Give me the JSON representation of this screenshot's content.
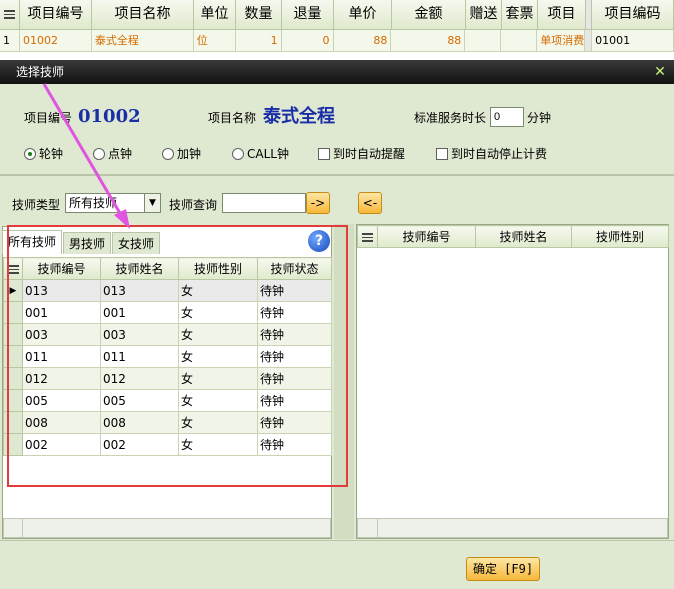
{
  "background_grid": {
    "columns": [
      "",
      "项目编号",
      "项目名称",
      "单位",
      "数量",
      "退量",
      "单价",
      "金额",
      "赠送",
      "套票",
      "项目",
      "项目编码"
    ],
    "row": [
      "1",
      "01002",
      "泰式全程",
      "位",
      "1",
      "0",
      "88",
      "88",
      "",
      "",
      "单项消费",
      "01001"
    ]
  },
  "dialog": {
    "title": "选择技师",
    "item_code_label": "项目编号",
    "item_code": "01002",
    "item_name_label": "项目名称",
    "item_name": "泰式全程",
    "duration_label": "标准服务时长",
    "duration_value": "0",
    "duration_unit": "分钟",
    "radios": [
      {
        "label": "轮钟",
        "checked": true
      },
      {
        "label": "点钟",
        "checked": false
      },
      {
        "label": "加钟",
        "checked": false
      },
      {
        "label": "CALL钟",
        "checked": false
      }
    ],
    "checkboxes": [
      {
        "label": "到时自动提醒"
      },
      {
        "label": "到时自动停止计费"
      }
    ],
    "tech_type_label": "技师类型",
    "tech_type_value": "所有技师",
    "tech_query_label": "技师查询",
    "tabs": [
      "所有技师",
      "男技师",
      "女技师"
    ],
    "left_table": {
      "headers": [
        "技师编号",
        "技师姓名",
        "技师性别",
        "技师状态"
      ],
      "rows": [
        [
          "013",
          "013",
          "女",
          "待钟"
        ],
        [
          "001",
          "001",
          "女",
          "待钟"
        ],
        [
          "003",
          "003",
          "女",
          "待钟"
        ],
        [
          "011",
          "011",
          "女",
          "待钟"
        ],
        [
          "012",
          "012",
          "女",
          "待钟"
        ],
        [
          "005",
          "005",
          "女",
          "待钟"
        ],
        [
          "008",
          "008",
          "女",
          "待钟"
        ],
        [
          "002",
          "002",
          "女",
          "待钟"
        ]
      ]
    },
    "right_table": {
      "headers": [
        "技师编号",
        "技师姓名",
        "技师性别"
      ]
    },
    "add_button": "->",
    "remove_button": "<-",
    "confirm_button": "确定 [F9]",
    "colors": {
      "title_bg": "#1a1a1a",
      "panel_bg": "#dfe8d0",
      "accent_blue": "#1a2ea8",
      "highlight_red": "#e23b3b",
      "annotation_arrow": "#e055e0"
    },
    "icons": [
      "close-icon",
      "help-icon",
      "grid-icon",
      "row-pointer-icon",
      "dropdown-arrow-icon"
    ]
  }
}
